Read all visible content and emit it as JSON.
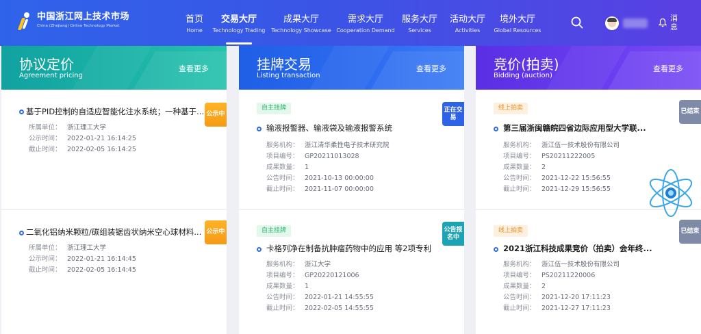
{
  "header": {
    "logo_title": "中国浙江网上技术市场",
    "logo_subtitle": "China (Zhejiang) Online Technology Market",
    "nav": [
      {
        "zh": "首页",
        "en": "Home"
      },
      {
        "zh": "交易大厅",
        "en": "Technology Trading",
        "active": true
      },
      {
        "zh": "成果大厅",
        "en": "Technology Showcase"
      },
      {
        "zh": "需求大厅",
        "en": "Cooperation Demand"
      },
      {
        "zh": "服务大厅",
        "en": "Services"
      },
      {
        "zh": "活动大厅",
        "en": "Activities"
      },
      {
        "zh": "境外大厅",
        "en": "Global Resources"
      }
    ],
    "message_label": "消息"
  },
  "columns": [
    {
      "title": "协议定价",
      "subtitle": "Agreement pricing",
      "more": "查看更多",
      "items": [
        {
          "title": "基于PID控制的自适应智能化注水系统；一种基于...",
          "badge": "公示中",
          "fields": [
            {
              "k": "所属单位：",
              "v": "浙江理工大学"
            },
            {
              "k": "公示时间：",
              "v": "2022-01-21 16:14:25"
            },
            {
              "k": "截止时间：",
              "v": "2022-02-05 16:14:25"
            }
          ]
        },
        {
          "title": "二氧化铝纳米颗粒/碳组装锯齿状纳米空心球材料...",
          "badge": "公示中",
          "fields": [
            {
              "k": "所属单位：",
              "v": "浙江理工大学"
            },
            {
              "k": "公示时间：",
              "v": "2022-01-21 16:14:45"
            },
            {
              "k": "截止时间：",
              "v": "2022-02-05 16:14:45"
            }
          ]
        }
      ]
    },
    {
      "title": "挂牌交易",
      "subtitle": "Listing transaction",
      "more": "查看更多",
      "items": [
        {
          "tag": "自主挂牌",
          "title": "输液报警器、输液袋及输液报警系统",
          "badge": "正在交易",
          "fields": [
            {
              "k": "服务机构：",
              "v": "浙江清华柔性电子技术研究院"
            },
            {
              "k": "项目编号：",
              "v": "GP20211013028"
            },
            {
              "k": "成果数量：",
              "v": "1"
            },
            {
              "k": "公告时间：",
              "v": "2021-10-13 00:00:00"
            },
            {
              "k": "截止时间：",
              "v": "2021-11-07 00:00:00"
            }
          ]
        },
        {
          "tag": "自主挂牌",
          "title": "卡格列净在制备抗肿瘤药物中的应用 等2项专利",
          "badge": "公告报名中",
          "fields": [
            {
              "k": "服务机构：",
              "v": "浙江大学"
            },
            {
              "k": "项目编号：",
              "v": "GP20220121006"
            },
            {
              "k": "成果数量：",
              "v": "1"
            },
            {
              "k": "公告时间：",
              "v": "2022-01-21 14:55:55"
            },
            {
              "k": "截止时间：",
              "v": "2022-02-05 14:55:55"
            }
          ]
        }
      ]
    },
    {
      "title": "竞价(拍卖)",
      "subtitle": "Bidding (auction)",
      "more": "查看更多",
      "items": [
        {
          "tag": "线上拍卖",
          "title": "第三届浙闽赣皖四省边际应用型大学联...",
          "badge": "已结束",
          "fields": [
            {
              "k": "服务机构：",
              "v": "浙江伍一技术股份有限公司"
            },
            {
              "k": "项目编号：",
              "v": "PS20211222005"
            },
            {
              "k": "成果数量：",
              "v": "2"
            },
            {
              "k": "公告时间：",
              "v": "2021-12-22 15:56:55"
            },
            {
              "k": "截止时间：",
              "v": "2021-12-29 15:56:55"
            }
          ]
        },
        {
          "tag": "线上拍卖",
          "title": "2021浙江科技成果竞价（拍卖）会年终...",
          "badge": "已结束",
          "fields": [
            {
              "k": "服务机构：",
              "v": "浙江伍一技术股份有限公司"
            },
            {
              "k": "项目编号：",
              "v": "PS20211220006"
            },
            {
              "k": "成果数量：",
              "v": "2"
            },
            {
              "k": "公告时间：",
              "v": "2021-12-20 17:11:23"
            },
            {
              "k": "截止时间：",
              "v": "2021-12-27 17:11:23"
            }
          ]
        }
      ]
    }
  ],
  "colors": {
    "header_start": "#2f63ea",
    "header_end": "#5a3fe3",
    "col1_head": "#11a2a0",
    "col2_head": "#1f5fe6",
    "col3_head": "#5a2fe3",
    "badge_orange": "#f59a15",
    "badge_blue": "#2e63e8",
    "badge_teal": "#1ca3b4",
    "badge_grey": "#7f8aa6",
    "tag_green": "#2bb36a",
    "tag_orange": "#e7912a"
  },
  "icons": [
    "search-icon",
    "bell-icon",
    "avatar",
    "atom-icon"
  ]
}
